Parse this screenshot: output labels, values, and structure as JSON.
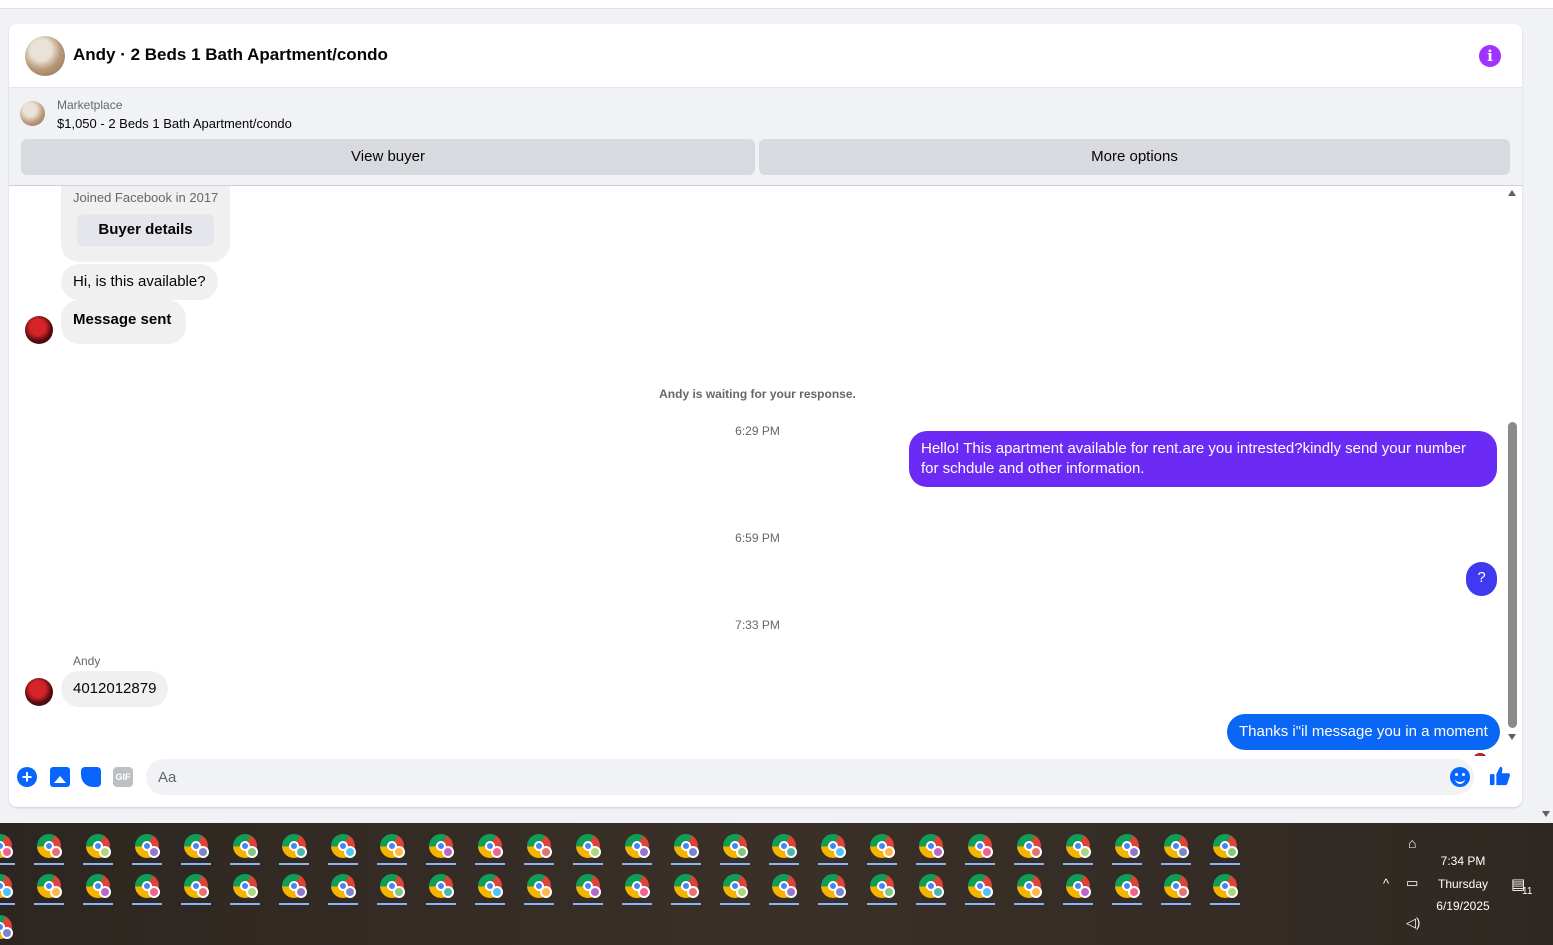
{
  "header": {
    "title": "Andy · 2 Beds 1 Bath Apartment/condo",
    "info_icon": "info-icon",
    "accent": "#a033ff"
  },
  "listing": {
    "source": "Marketplace",
    "title": "$1,050 - 2 Beds 1 Bath Apartment/condo",
    "view_buyer_label": "View buyer",
    "more_options_label": "More options"
  },
  "buyer_card": {
    "joined": "Joined Facebook in 2017",
    "details_label": "Buyer details"
  },
  "messages": {
    "m1": "Hi, is this available?",
    "m2": "Message sent",
    "waiting_note": "Andy is waiting for your response.",
    "t1": "6:29 PM",
    "m3_line1": "Hello! This apartment available for rent.are you intrested?kindly send your number",
    "m3_line2": "for schdule and other information.",
    "t2": "6:59 PM",
    "m4": "?",
    "t3": "7:33 PM",
    "sender": "Andy",
    "m5": "4012012879",
    "m6": "Thanks i\"il message you in a moment"
  },
  "composer": {
    "placeholder": "Aa",
    "value": "",
    "icons": [
      "plus-icon",
      "photo-icon",
      "sticker-icon",
      "gif-icon",
      "emoji-icon",
      "like-icon"
    ],
    "gif_label": "GIF",
    "accent": "#0866ff"
  },
  "taskbar": {
    "app_icon": "chrome-profile-icon",
    "time": "7:34 PM",
    "day": "Thursday",
    "date": "6/19/2025",
    "notification_count": "11"
  }
}
